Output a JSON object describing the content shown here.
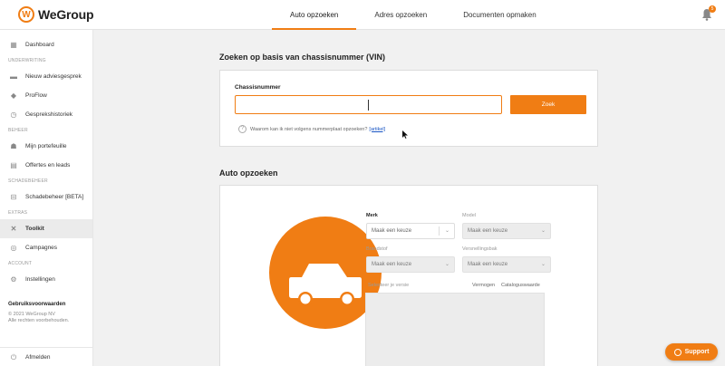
{
  "header": {
    "logo_text": "WeGroup",
    "tabs": [
      {
        "label": "Auto opzoeken",
        "active": true
      },
      {
        "label": "Adres opzoeken",
        "active": false
      },
      {
        "label": "Documenten opmaken",
        "active": false
      }
    ],
    "notification_count": "5"
  },
  "sidebar": {
    "dashboard": "Dashboard",
    "section_underwriting": "UNDERWRITING",
    "nieuw_adviesgesprek": "Nieuw adviesgesprek",
    "proflow": "ProFlow",
    "gespreks": "Gesprekshistoriek",
    "section_beheer": "BEHEER",
    "portefeuille": "Mijn portefeuille",
    "offertes": "Offertes en leads",
    "section_schadebeheer": "SCHADEBEHEER",
    "schadebeheer": "Schadebeheer [BETA]",
    "section_extras": "EXTRAS",
    "toolkit": "Toolkit",
    "campagnes": "Campagnes",
    "section_account": "ACCOUNT",
    "instellingen": "Instellingen",
    "terms": "Gebruiksvoorwaarden",
    "copyright": "© 2021 WeGroup NV",
    "rights": "Alle rechten voorbehouden.",
    "logout": "Afmelden"
  },
  "vin": {
    "title": "Zoeken op basis van chassisnummer (VIN)",
    "field_label": "Chassisnummer",
    "value": "",
    "button": "Zoek",
    "help_text": "Waarom kan ik niet volgens nummerplaat opzoeken?",
    "help_link": "[artikel]"
  },
  "auto": {
    "title": "Auto opzoeken",
    "merk_label": "Merk",
    "merk_value": "Maak een keuze",
    "model_label": "Model",
    "model_value": "Maak een keuze",
    "brandstof_label": "Brandstof",
    "brandstof_value": "Maak een keuze",
    "versnellingsbak_label": "Versnellingsbak",
    "versnellingsbak_value": "Maak een keuze",
    "versie_label": "Selecteer je versie",
    "vermogen_label": "Vermogen",
    "catalogus_label": "Cataloguswaarde"
  },
  "support": {
    "label": "Support"
  },
  "colors": {
    "accent": "#f07d14",
    "link": "#1a56c4"
  }
}
